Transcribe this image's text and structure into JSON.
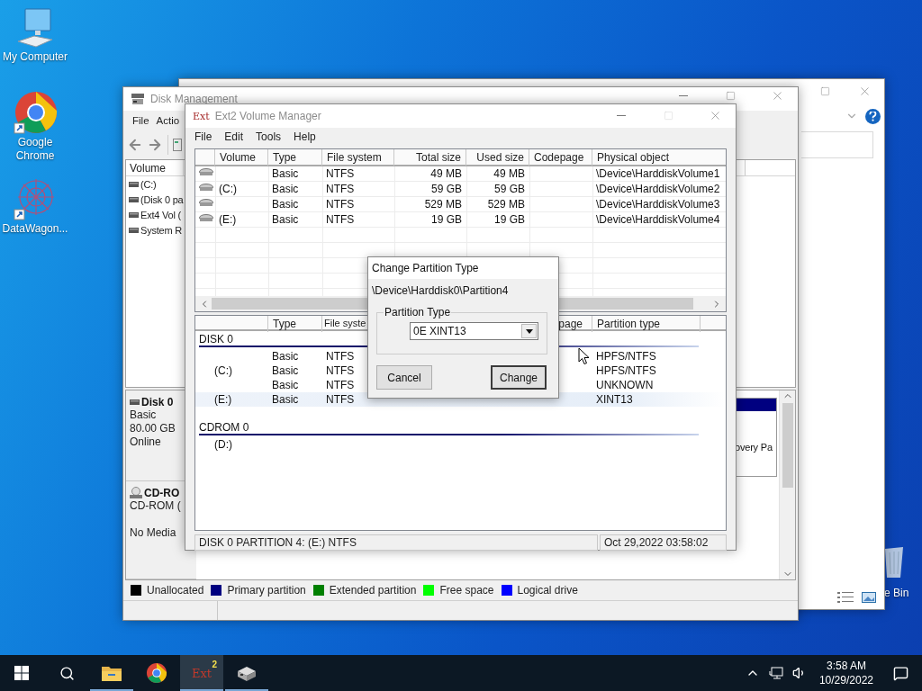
{
  "desktop_icons": [
    {
      "kind": "computer",
      "label": "My Computer"
    },
    {
      "kind": "browser",
      "label": "Google Chrome"
    },
    {
      "kind": "star",
      "label": "DataWagon..."
    }
  ],
  "recycle_bin": {
    "label": "e Bin"
  },
  "disk_management": {
    "title": "Disk Management",
    "menu": [
      "File",
      "Actio"
    ],
    "volume_header": "Volume",
    "volumes": [
      "(C:)",
      "(Disk 0 pa",
      "Ext4 Vol (",
      "System R"
    ],
    "disks": [
      {
        "kind": "disk",
        "name": "Disk 0",
        "type": "Basic",
        "size": "80.00 GB",
        "status": "Online"
      },
      {
        "kind": "cdrom",
        "name": "CD-RO",
        "type": "CD-ROM (",
        "status": "No Media"
      }
    ],
    "partition_label": "overy Pa",
    "legend": [
      {
        "label": "Unallocated",
        "color": "#000000"
      },
      {
        "label": "Primary partition",
        "color": "#000080"
      },
      {
        "label": "Extended partition",
        "color": "#008000"
      },
      {
        "label": "Free space",
        "color": "#00ff00"
      },
      {
        "label": "Logical drive",
        "color": "#0000ff"
      }
    ]
  },
  "ext2_manager": {
    "logo_text": "Ext",
    "title": "Ext2 Volume Manager",
    "menu": [
      "File",
      "Edit",
      "Tools",
      "Help"
    ],
    "volume_columns": [
      "Volume",
      "Type",
      "File system",
      "Total size",
      "Used size",
      "Codepage",
      "Physical object"
    ],
    "volumes": [
      {
        "type": "Basic",
        "file_system": "NTFS",
        "total_size": "49 MB",
        "used_size": "49 MB",
        "physical_object": "\\Device\\HarddiskVolume1"
      },
      {
        "volume": "(C:)",
        "type": "Basic",
        "file_system": "NTFS",
        "total_size": "59 GB",
        "used_size": "59 GB",
        "physical_object": "\\Device\\HarddiskVolume2"
      },
      {
        "type": "Basic",
        "file_system": "NTFS",
        "total_size": "529 MB",
        "used_size": "529 MB",
        "physical_object": "\\Device\\HarddiskVolume3"
      },
      {
        "volume": "(E:)",
        "type": "Basic",
        "file_system": "NTFS",
        "total_size": "19 GB",
        "used_size": "19 GB",
        "physical_object": "\\Device\\HarddiskVolume4"
      }
    ],
    "disk_header": {
      "type": "Type",
      "file_system": "File syste",
      "codepage": "page",
      "partition_type": "Partition type"
    },
    "disk_groups": [
      {
        "label": "DISK 0",
        "rows": [
          {
            "type": "Basic",
            "file_system": "NTFS",
            "partition_type": "HPFS/NTFS",
            "selected": false
          },
          {
            "volume": "(C:)",
            "type": "Basic",
            "file_system": "NTFS",
            "partition_type": "HPFS/NTFS",
            "selected": false
          },
          {
            "type": "Basic",
            "file_system": "NTFS",
            "partition_type": "UNKNOWN",
            "selected": false
          },
          {
            "volume": "(E:)",
            "type": "Basic",
            "file_system": "NTFS",
            "partition_type": "XINT13",
            "selected": true
          }
        ]
      },
      {
        "label": "CDROM 0",
        "rows": [
          {
            "volume": "(D:)",
            "selected": false
          }
        ]
      }
    ],
    "status": [
      "DISK 0 PARTITION 4: (E:) NTFS",
      "Oct 29,2022 03:58:02"
    ]
  },
  "dialog": {
    "title": "Change Partition Type",
    "device": "\\Device\\Harddisk0\\Partition4",
    "group_label": "Partition Type",
    "selection": "0E XINT13",
    "buttons": [
      {
        "label": "Cancel",
        "default": false
      },
      {
        "label": "Change",
        "default": true
      }
    ]
  },
  "taskbar": {
    "apps": [
      {
        "kind": "folder",
        "running": true,
        "active": false
      },
      {
        "kind": "browser",
        "running": false,
        "active": false
      },
      {
        "kind": "ext",
        "logo_text": "Ext",
        "badge": "2",
        "running": true,
        "active": true
      },
      {
        "kind": "drive",
        "running": true,
        "active": false
      }
    ],
    "clock": {
      "time": "3:58 AM",
      "date": "10/29/2022"
    }
  }
}
